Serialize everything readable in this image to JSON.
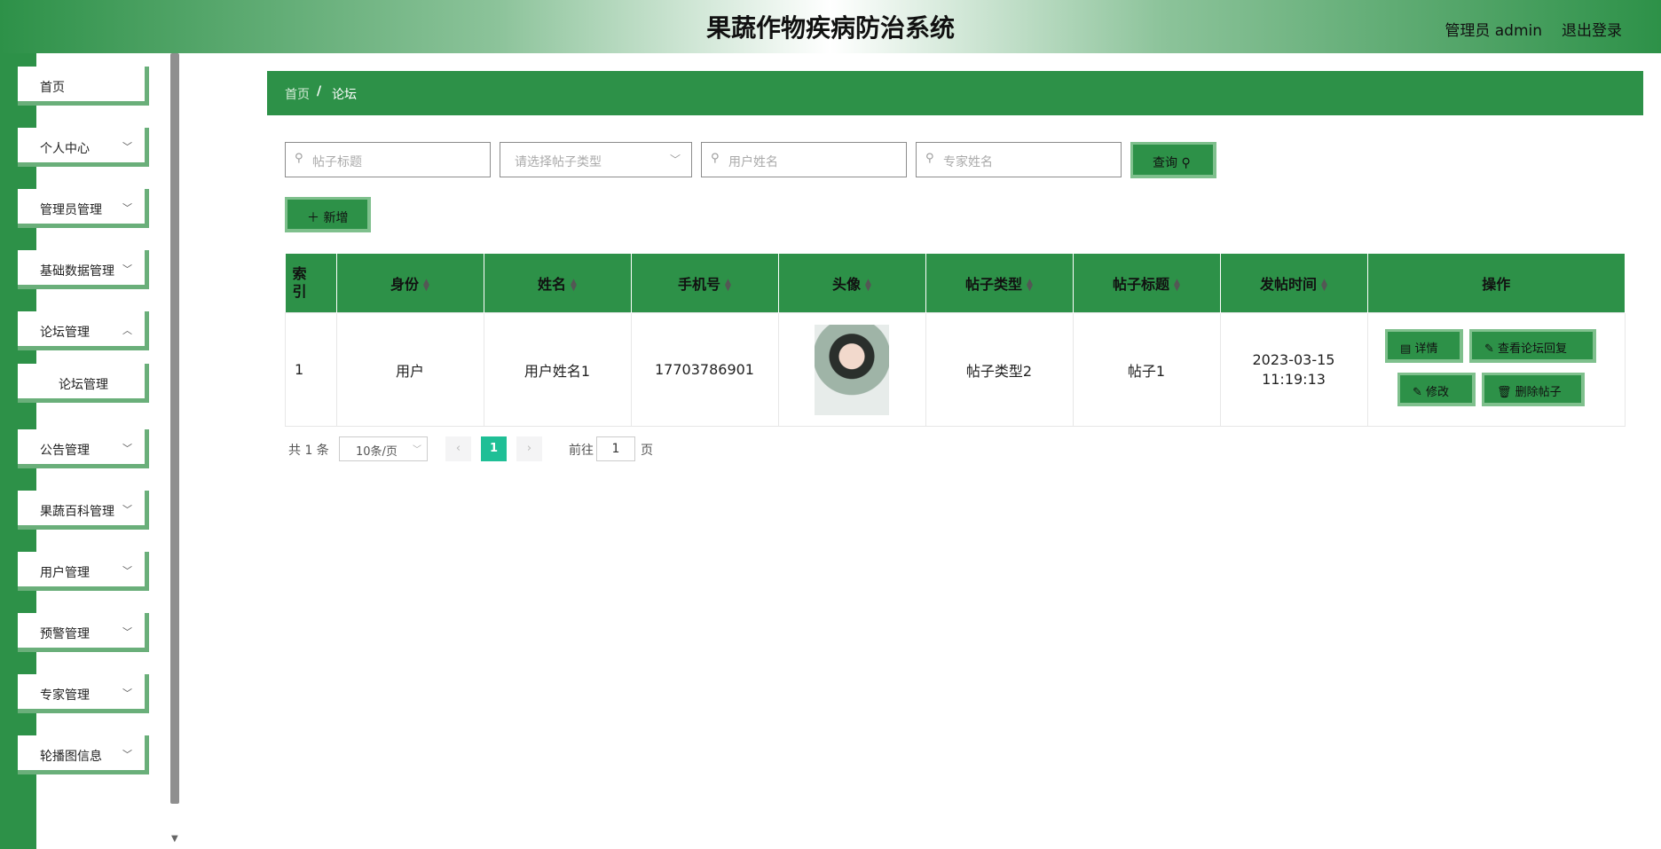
{
  "header": {
    "title": "果蔬作物疾病防治系统",
    "user": "管理员 admin",
    "logout": "退出登录"
  },
  "sidebar": {
    "items": [
      {
        "label": "首页",
        "has_children": false
      },
      {
        "label": "个人中心",
        "has_children": true
      },
      {
        "label": "管理员管理",
        "has_children": true
      },
      {
        "label": "基础数据管理",
        "has_children": true
      },
      {
        "label": "论坛管理",
        "has_children": true
      },
      {
        "label": "论坛管理",
        "sub": true
      },
      {
        "label": "公告管理",
        "has_children": true
      },
      {
        "label": "果蔬百科管理",
        "has_children": true
      },
      {
        "label": "用户管理",
        "has_children": true
      },
      {
        "label": "预警管理",
        "has_children": true
      },
      {
        "label": "专家管理",
        "has_children": true
      },
      {
        "label": "轮播图信息",
        "has_children": true
      }
    ]
  },
  "breadcrumb": {
    "home": "首页",
    "separator": "/",
    "current": "论坛"
  },
  "search": {
    "title_placeholder": "帖子标题",
    "type_placeholder": "请选择帖子类型",
    "user_placeholder": "用户姓名",
    "expert_placeholder": "专家姓名",
    "query_label": "查询"
  },
  "actions": {
    "add_label": "新增"
  },
  "table": {
    "headers": [
      "索引",
      "身份",
      "姓名",
      "手机号",
      "头像",
      "帖子类型",
      "帖子标题",
      "发帖时间",
      "操作"
    ],
    "rows": [
      {
        "index": "1",
        "identity": "用户",
        "name": "用户姓名1",
        "phone": "17703786901",
        "post_type": "帖子类型2",
        "post_title": "帖子1",
        "post_time": "2023-03-15 11:19:13"
      }
    ],
    "row_actions": {
      "detail": "详情",
      "view_replies": "查看论坛回复",
      "edit": "修改",
      "delete": "删除帖子"
    }
  },
  "pagination": {
    "total": "共 1 条",
    "page_size": "10条/页",
    "current_page": "1",
    "goto_prefix": "前往",
    "goto_value": "1",
    "goto_suffix": "页"
  },
  "colors": {
    "primary": "#2d9148",
    "accent_border": "#7fc08d",
    "page_active": "#1fbf96"
  }
}
